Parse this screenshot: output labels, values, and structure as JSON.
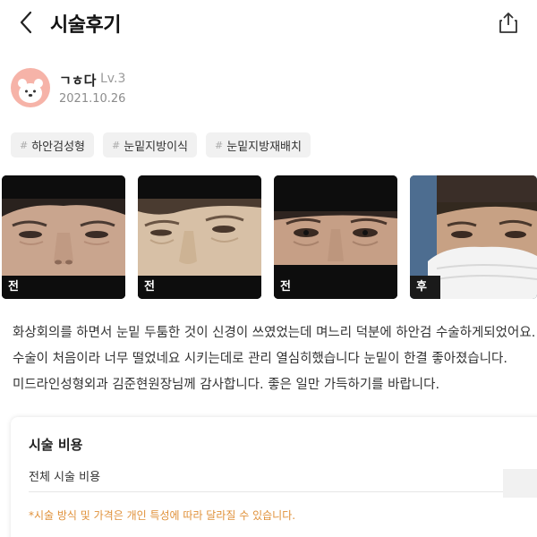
{
  "header": {
    "title": "시술후기"
  },
  "user": {
    "name": "ㄱㅎ다",
    "level": "Lv.3",
    "date": "2021.10.26"
  },
  "tags": [
    {
      "hash": "#",
      "label": "하안검성형"
    },
    {
      "hash": "#",
      "label": "눈밑지방이식"
    },
    {
      "hash": "#",
      "label": "눈밑지방재배치"
    }
  ],
  "photos": [
    {
      "badge": "전"
    },
    {
      "badge": "전"
    },
    {
      "badge": "전"
    },
    {
      "badge": "후"
    }
  ],
  "review": {
    "lines": [
      "화상회의를 하면서 눈밑 두툼한 것이 신경이 쓰였었는데 며느리 덕분에 하안검 수술하게되었어요.",
      "수술이 처음이라 너무 떨었네요 시키는데로 관리 열심히했습니다 눈밑이 한결 좋아졌습니다.",
      "미드라인성형외과 김준현원장님께 감사합니다. 좋은 일만 가득하기를 바랍니다."
    ]
  },
  "cost": {
    "title": "시술 비용",
    "total_label": "전체 시술 비용",
    "note": "*시술 방식 및 가격은 개인 특성에 따라 달라질 수 있습니다."
  },
  "colors": {
    "avatar_bg": "#f6b3a8",
    "note": "#e0913a",
    "tag_bg": "#f1f1f1"
  },
  "icons": {
    "back": "chevron-left-icon",
    "share": "share-icon",
    "avatar": "bear-avatar-icon"
  }
}
